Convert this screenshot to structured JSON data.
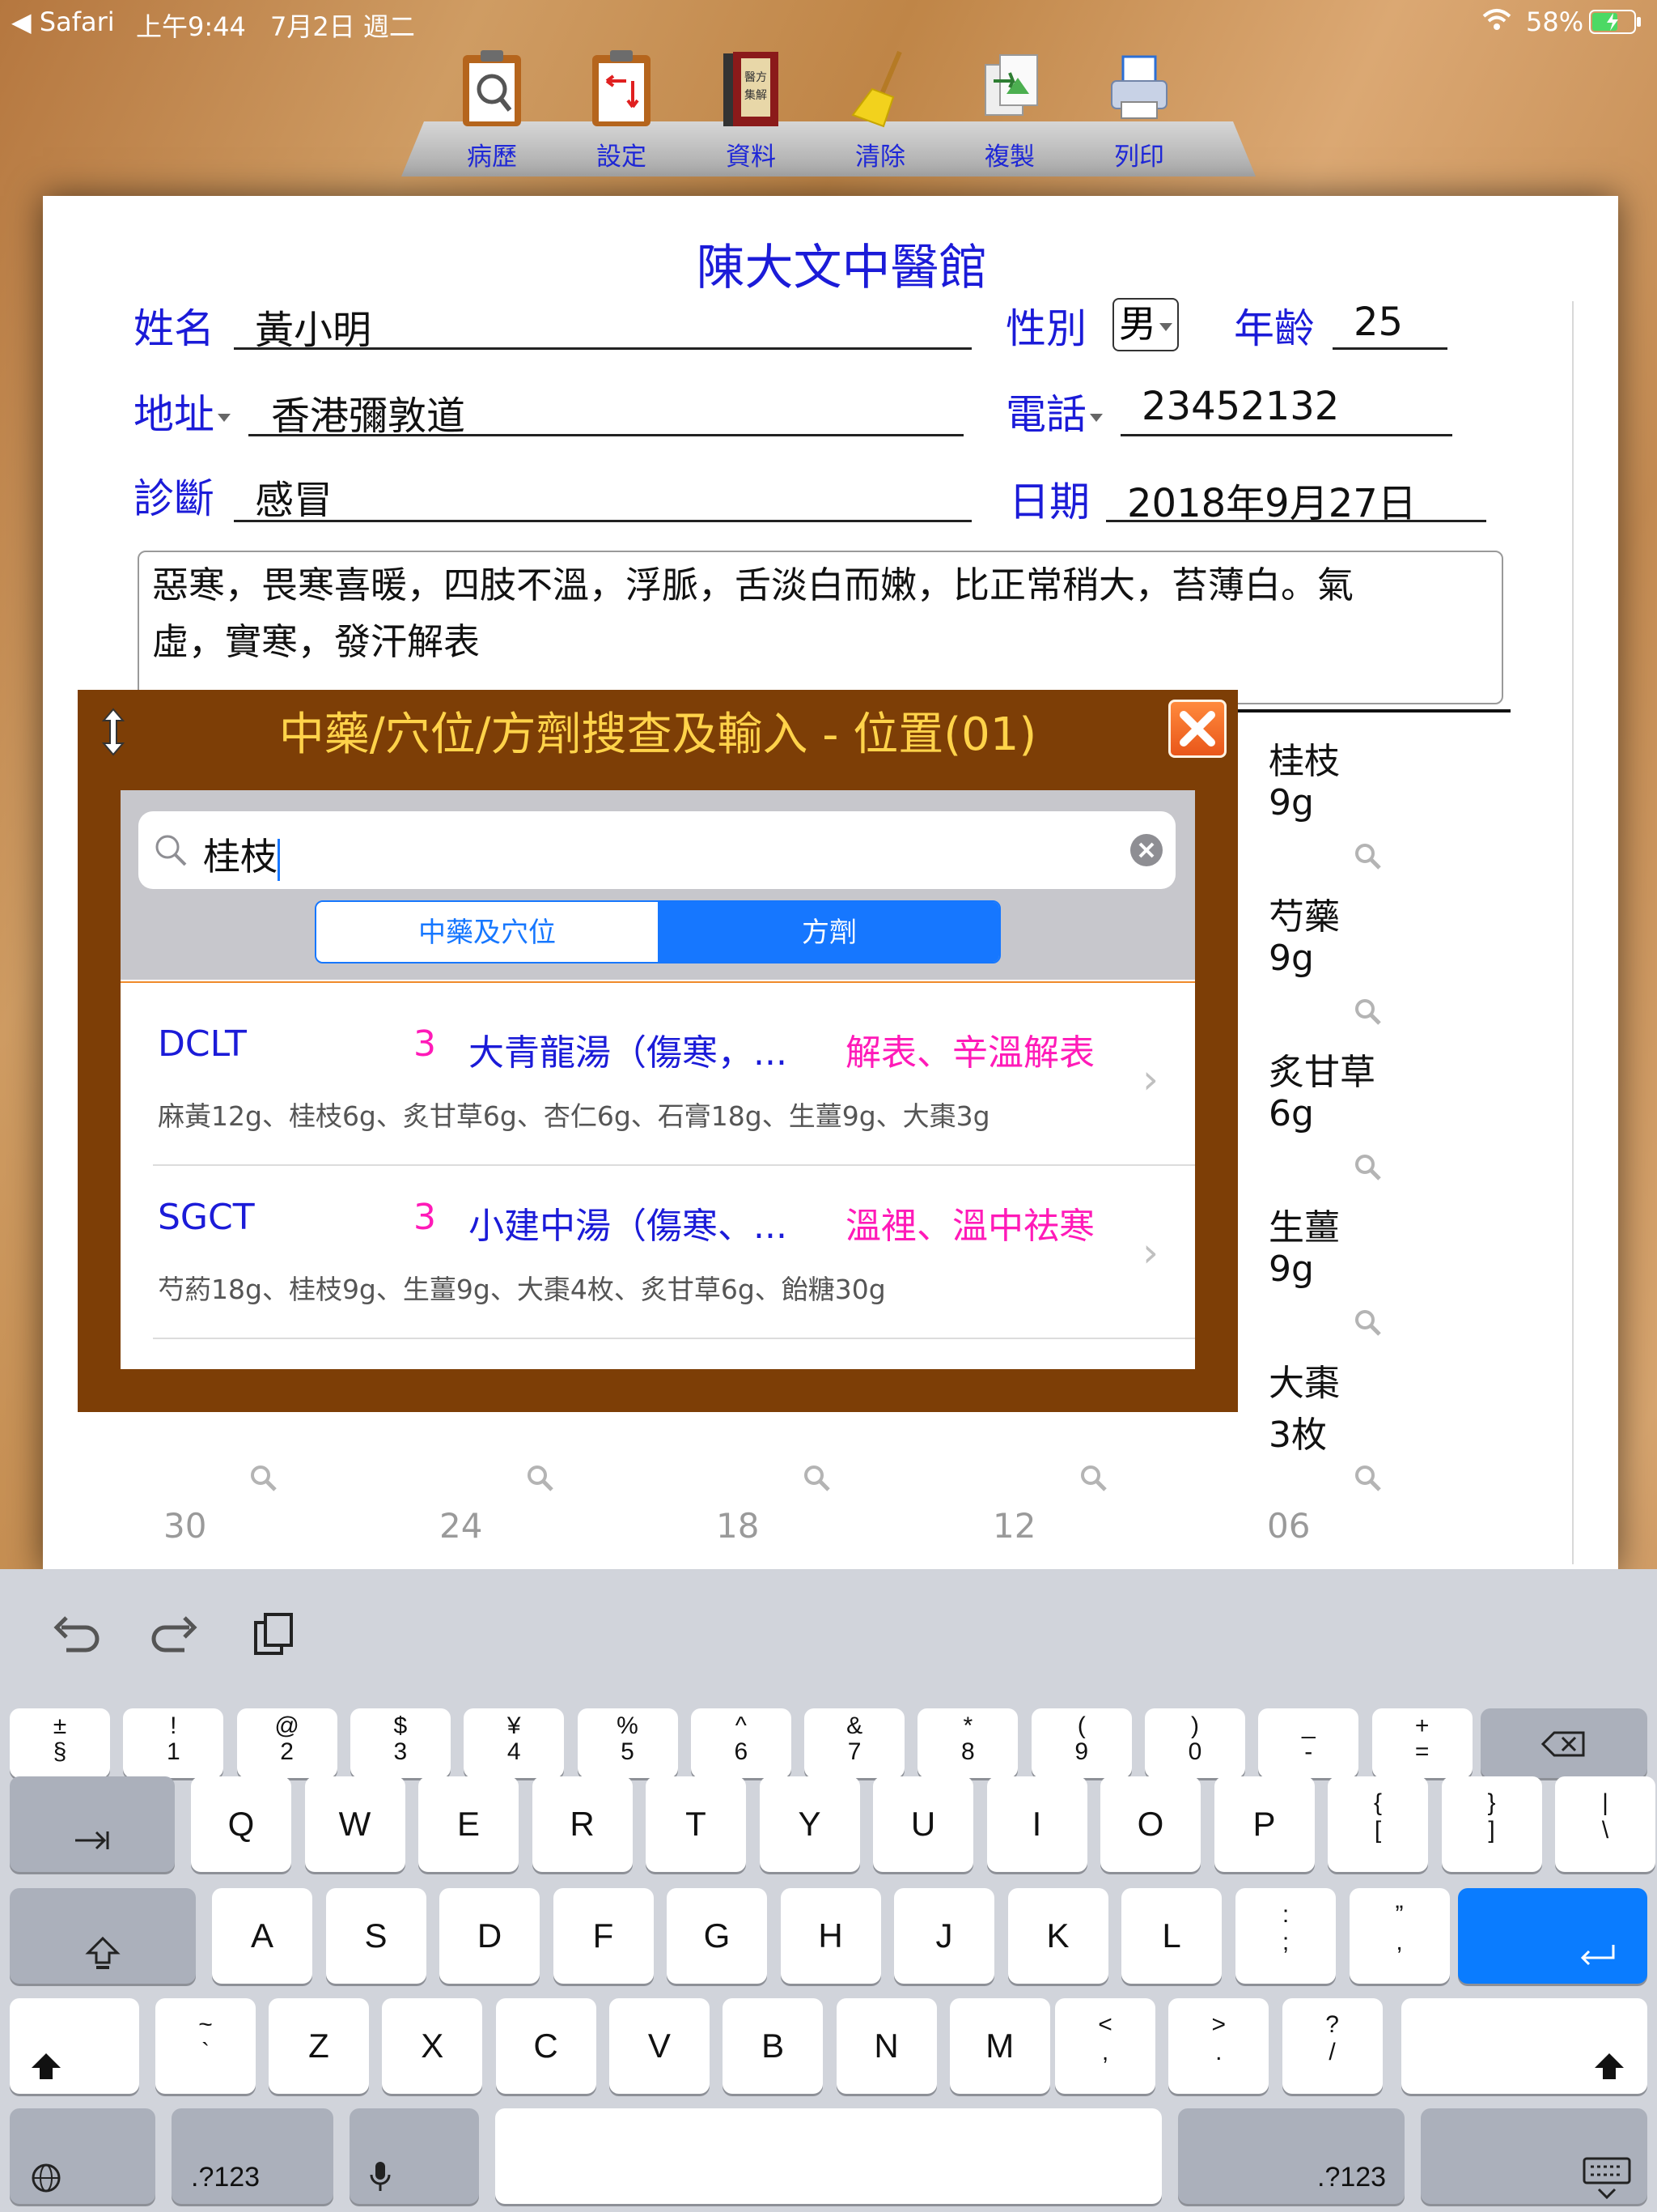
{
  "status": {
    "back": "◀ Safari",
    "time": "上午9:44",
    "date": "7月2日 週二",
    "battery": "58%"
  },
  "toolbar": [
    {
      "label": "病歷",
      "icon": "clipboard-search-icon"
    },
    {
      "label": "設定",
      "icon": "clipboard-settings-icon"
    },
    {
      "label": "資料",
      "icon": "books-icon"
    },
    {
      "label": "清除",
      "icon": "broom-icon"
    },
    {
      "label": "複製",
      "icon": "copy-documents-icon"
    },
    {
      "label": "列印",
      "icon": "printer-icon"
    }
  ],
  "form": {
    "clinic": "陳大文中醫館",
    "name_label": "姓名",
    "name": "黃小明",
    "gender_label": "性別",
    "gender": "男",
    "age_label": "年齡",
    "age": "25",
    "address_label": "地址",
    "address": "香港彌敦道",
    "phone_label": "電話",
    "phone": "23452132",
    "diagnosis_label": "診斷",
    "diagnosis": "感冒",
    "date_label": "日期",
    "date": "2018年9月27日",
    "notes_line1": "惡寒，畏寒喜暖，四肢不溫，浮脈，舌淡白而嫩，比正常稍大，苔薄白。氣",
    "notes_line2": "虛，實寒，發汗解表"
  },
  "herbs": [
    {
      "name": "桂枝",
      "dose": "9g"
    },
    {
      "name": "芍藥",
      "dose": "9g"
    },
    {
      "name": "炙甘草",
      "dose": "6g"
    },
    {
      "name": "生薑",
      "dose": "9g"
    },
    {
      "name": "大棗",
      "dose": "3枚"
    }
  ],
  "columns": [
    "30",
    "24",
    "18",
    "12",
    "06"
  ],
  "popup": {
    "title": "中藥/穴位/方劑搜查及輸入 - 位置(01)",
    "search_value": "桂枝",
    "seg_left": "中藥及穴位",
    "seg_right": "方劑",
    "results": [
      {
        "code": "DCLT",
        "count": "3",
        "name": "大青龍湯（傷寒，...",
        "effect": "解表、辛溫解表",
        "ingredients": "麻黃12g、桂枝6g、炙甘草6g、杏仁6g、石膏18g、生薑9g、大棗3g"
      },
      {
        "code": "SGCT",
        "count": "3",
        "name": "小建中湯（傷寒、...",
        "effect": "溫裡、溫中祛寒",
        "ingredients": "芍葯18g、桂枝9g、生薑9g、大棗4枚、炙甘草6g、飴糖30g"
      }
    ]
  },
  "keyboard": {
    "numrow": [
      [
        "±",
        "§"
      ],
      [
        "!",
        "1"
      ],
      [
        "@",
        "2"
      ],
      [
        "$",
        "3"
      ],
      [
        "¥",
        "4"
      ],
      [
        "%",
        "5"
      ],
      [
        "^",
        "6"
      ],
      [
        "&",
        "7"
      ],
      [
        "*",
        "8"
      ],
      [
        "(",
        "9"
      ],
      [
        ")",
        "0"
      ],
      [
        "_",
        "-"
      ],
      [
        "+",
        "="
      ]
    ],
    "row1": [
      "Q",
      "W",
      "E",
      "R",
      "T",
      "Y",
      "U",
      "I",
      "O",
      "P"
    ],
    "row1_extra": [
      [
        "{",
        "["
      ],
      [
        "}",
        "]"
      ],
      [
        "|",
        "\\"
      ]
    ],
    "row2": [
      "A",
      "S",
      "D",
      "F",
      "G",
      "H",
      "J",
      "K",
      "L"
    ],
    "row2_extra": [
      [
        ":",
        ";"
      ],
      [
        "”",
        ","
      ]
    ],
    "row3_extra_left": [
      [
        "~",
        "`"
      ]
    ],
    "row3": [
      "Z",
      "X",
      "C",
      "V",
      "B",
      "N",
      "M"
    ],
    "row3_extra": [
      [
        "<",
        ","
      ],
      [
        ">",
        "."
      ],
      [
        "?",
        "/"
      ]
    ],
    "num_switch": ".?123"
  }
}
